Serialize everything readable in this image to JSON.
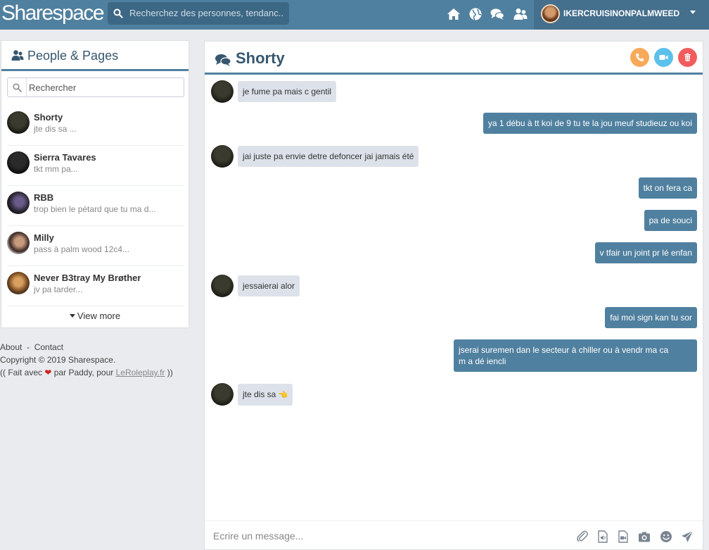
{
  "topbar": {
    "logo": "Sharespace",
    "search_placeholder": "Recherchez des personnes, tendanc...",
    "user_name": "IKERCRUISINONPALMWEED"
  },
  "people": {
    "title": "People & Pages",
    "search_placeholder": "Rechercher",
    "contacts": [
      {
        "name": "Shorty",
        "preview": "jte dis sa ..."
      },
      {
        "name": "Sierra Tavares",
        "preview": "tkt mm pa..."
      },
      {
        "name": "RBB",
        "preview": "trop bien le pétard que tu ma d..."
      },
      {
        "name": "Milly",
        "preview": "pass à palm wood 12c4..."
      },
      {
        "name": "Never B3tray My Brøther",
        "preview": "jv pa tarder..."
      }
    ],
    "view_more": "View more"
  },
  "footer": {
    "about": "About",
    "sep": "-",
    "contact": "Contact",
    "copyright": "Copyright © 2019 Sharespace.",
    "made_prefix": "(( Fait avec",
    "made_middle": "par Paddy, pour",
    "made_link": "LeRoleplay.fr",
    "made_suffix": "))"
  },
  "chat": {
    "title": "Shorty",
    "messages": [
      {
        "dir": "in",
        "text": "je fume pa mais c gentil"
      },
      {
        "dir": "out",
        "text": "ya 1 débu à tt koi de 9 tu te la jou meuf studieuz ou koi"
      },
      {
        "dir": "in",
        "text": "jai juste pa envie detre defoncer jai jamais été"
      },
      {
        "dir": "out",
        "text": "tkt on fera ca"
      },
      {
        "dir": "out",
        "text": "pa de souci"
      },
      {
        "dir": "out",
        "text": "v tfair un joint pr lé enfan"
      },
      {
        "dir": "in",
        "text": "jessaierai alor"
      },
      {
        "dir": "out",
        "text": "fai moi sign kan tu sor"
      },
      {
        "dir": "out",
        "text_line1": "jserai suremen dan le secteur à chiller ou à vendr ma ca",
        "text_line2": "m a dé iencli"
      },
      {
        "dir": "in",
        "text": "jte dis sa",
        "emoji": "👈"
      }
    ],
    "composer_placeholder": "Ecrire un message..."
  },
  "colors": {
    "brand": "#50809f",
    "call": "#f7a95a",
    "video": "#5bc0eb",
    "delete": "#f25c5c"
  },
  "icons": [
    "search-icon",
    "home-icon",
    "globe-icon",
    "chat-icon",
    "friends-icon",
    "people-icon",
    "phone-icon",
    "video-icon",
    "trash-icon",
    "paperclip-icon",
    "audio-file-icon",
    "video-file-icon",
    "camera-icon",
    "smiley-icon",
    "send-icon"
  ]
}
